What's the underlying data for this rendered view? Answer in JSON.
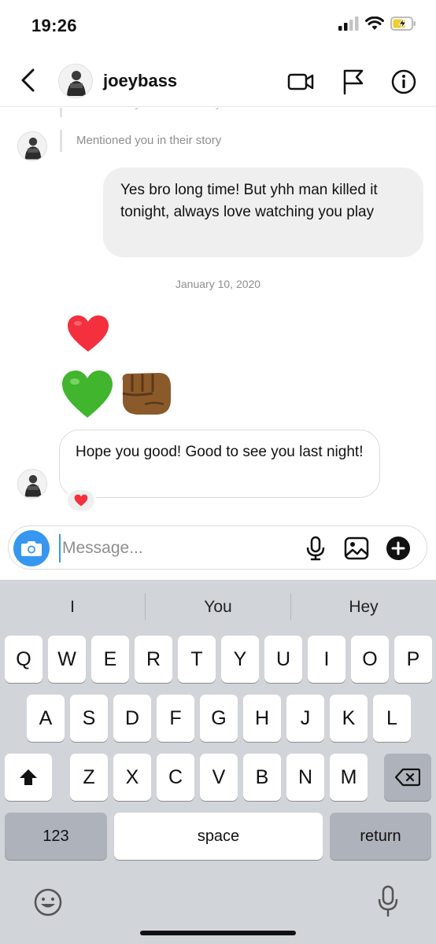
{
  "status_bar": {
    "time": "19:26",
    "icons": [
      "signal-icon",
      "wifi-icon",
      "battery-charging-icon"
    ]
  },
  "header": {
    "username": "joeybass",
    "icons": [
      "back-icon",
      "video-call-icon",
      "flag-icon",
      "info-icon"
    ]
  },
  "chat": {
    "story_mention_cut": "Mentioned you in their story",
    "story_mention": "Mentioned you in their story",
    "outgoing_message": "Yes bro long time! But yhh man killed it tonight, always love watching you play",
    "date_separator": "January 10, 2020",
    "emoji_red_heart": "❤️",
    "emoji_green_heart": "💚",
    "emoji_fist": "👊🏾",
    "incoming_message": "Hope you good! Good to see you last night!",
    "reaction": "❤️"
  },
  "composer": {
    "placeholder": "Message...",
    "icons": [
      "camera-icon",
      "microphone-icon",
      "gallery-icon",
      "plus-icon"
    ]
  },
  "keyboard": {
    "suggestions": [
      "I",
      "You",
      "Hey"
    ],
    "row1": [
      "Q",
      "W",
      "E",
      "R",
      "T",
      "Y",
      "U",
      "I",
      "O",
      "P"
    ],
    "row2": [
      "A",
      "S",
      "D",
      "F",
      "G",
      "H",
      "J",
      "K",
      "L"
    ],
    "row3": [
      "Z",
      "X",
      "C",
      "V",
      "B",
      "N",
      "M"
    ],
    "numbers_key": "123",
    "space_key": "space",
    "return_key": "return",
    "icons": [
      "shift-icon",
      "backspace-icon",
      "emoji-icon",
      "dictation-mic-icon"
    ]
  },
  "colors": {
    "accent": "#3797f0",
    "bubble_out": "#efefef",
    "keyboard_bg": "#d1d4d9",
    "heart_red": "#ff3040"
  }
}
